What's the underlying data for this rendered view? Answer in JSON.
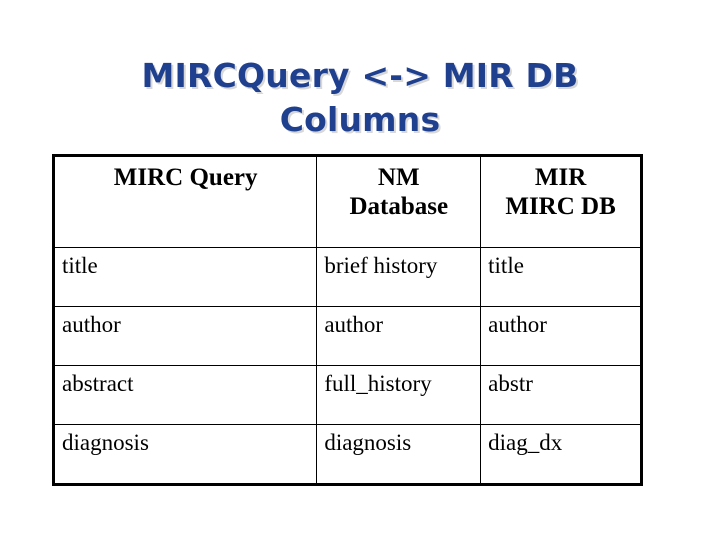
{
  "slide": {
    "title": "MIRCQuery <-> MIR DB\nColumns",
    "title_color": "#1f3f8f",
    "title_shadow_color": "#d8d8d8",
    "background_color": "#ffffff"
  },
  "table": {
    "border_color": "#000000",
    "headers": [
      "MIRC Query",
      "NM\nDatabase",
      "MIR\nMIRC DB"
    ],
    "rows": [
      {
        "mirc_query": "title",
        "nm_database": "brief history",
        "mir_mirc_db": "title"
      },
      {
        "mirc_query": "author",
        "nm_database": "author",
        "mir_mirc_db": "author"
      },
      {
        "mirc_query": "abstract",
        "nm_database": "full_history",
        "mir_mirc_db": "abstr"
      },
      {
        "mirc_query": "diagnosis",
        "nm_database": "diagnosis",
        "mir_mirc_db": "diag_dx"
      }
    ]
  }
}
